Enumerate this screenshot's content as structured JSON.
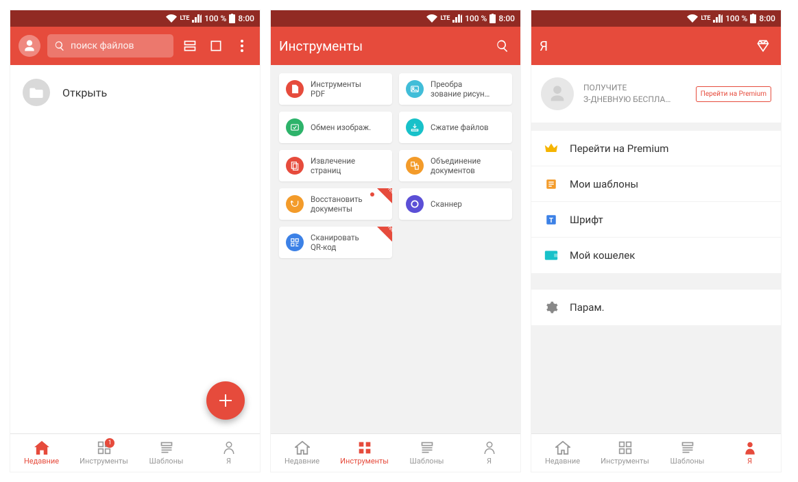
{
  "status": {
    "lte": "LTE",
    "battery": "100 %",
    "time": "8:00"
  },
  "screen1": {
    "search_placeholder": "поиск файлов",
    "open_label": "Открыть",
    "nav": {
      "recent": "Недавние",
      "tools": "Инструменты",
      "templates": "Шаблоны",
      "me": "Я",
      "badge": "1"
    }
  },
  "screen2": {
    "title": "Инструменты",
    "tools": [
      {
        "l1": "Инструменты",
        "l2": "PDF",
        "color": "#e64b3c"
      },
      {
        "l1": "Преобра",
        "l2": "зование рисун…",
        "color": "#41bdd8"
      },
      {
        "l1": "Обмен изображ.",
        "l2": "",
        "color": "#2db36a"
      },
      {
        "l1": "Сжатие файлов",
        "l2": "",
        "color": "#18c1c9"
      },
      {
        "l1": "Извлечение",
        "l2": "страниц",
        "color": "#e64b3c"
      },
      {
        "l1": "Объединение",
        "l2": "документов",
        "color": "#f39b2a"
      },
      {
        "l1": "Восстановить",
        "l2": "документы",
        "color": "#f39b2a",
        "free": true,
        "dot": true
      },
      {
        "l1": "Сканнер",
        "l2": "",
        "color": "#5b4fd6"
      },
      {
        "l1": "Сканировать",
        "l2": "QR-код",
        "color": "#3c81e6",
        "free": true
      }
    ],
    "free_label": "Free",
    "nav": {
      "recent": "Недавние",
      "tools": "Инструменты",
      "templates": "Шаблоны",
      "me": "Я"
    }
  },
  "screen3": {
    "title": "Я",
    "promo_l1": "ПОЛУЧИТЕ",
    "promo_l2": "З-ДНЕВНУЮ БЕСПЛА…",
    "promo_btn": "Перейти на Premium",
    "menu": [
      {
        "label": "Перейти на Premium",
        "icon": "crown",
        "color": "#f5b400"
      },
      {
        "label": "Мои шаблоны",
        "icon": "template",
        "color": "#f39b2a"
      },
      {
        "label": "Шрифт",
        "icon": "font",
        "color": "#3c81e6"
      },
      {
        "label": "Мой кошелек",
        "icon": "wallet",
        "color": "#18c1c9"
      }
    ],
    "settings_label": "Парам.",
    "nav": {
      "recent": "Недавние",
      "tools": "Инструменты",
      "templates": "Шаблоны",
      "me": "Я"
    }
  }
}
